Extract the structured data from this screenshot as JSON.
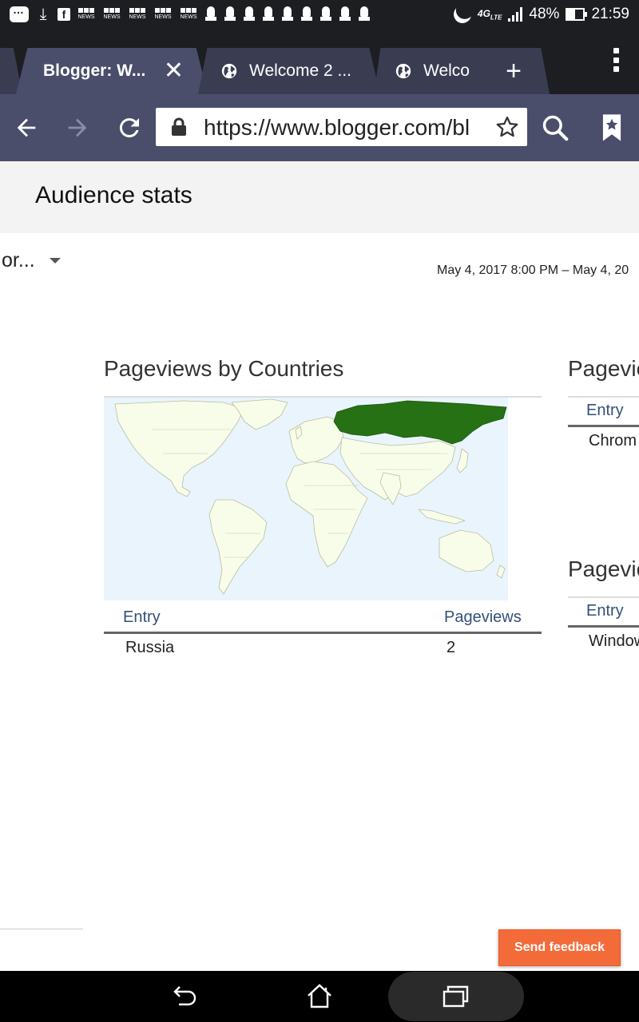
{
  "status_bar": {
    "battery": "48%",
    "time": "21:59",
    "network": "4G",
    "network_sub": "LTE",
    "news_badge": "NEWS",
    "icons": [
      "notification-icon",
      "download-icon",
      "facebook-icon",
      "bbc-news-icon",
      "bbc-news-icon",
      "bbc-news-icon",
      "bbc-news-icon",
      "bbc-news-icon",
      "pin-icon",
      "moon-icon",
      "signal-icon",
      "battery-icon"
    ]
  },
  "tabs": [
    {
      "label": "Blogger: W...",
      "active": true
    },
    {
      "label": "Welcome 2 ...",
      "active": false
    },
    {
      "label": "Welco",
      "active": false
    }
  ],
  "tab_icons": {
    "close": "close-icon",
    "new_tab": "plus-icon",
    "menu": "more-vert-icon",
    "site": "globe-icon"
  },
  "toolbar": {
    "url": "https://www.blogger.com/bl",
    "icons": [
      "back-arrow-icon",
      "forward-arrow-icon",
      "reload-icon",
      "lock-icon",
      "star-icon",
      "search-icon",
      "bookmark-icon"
    ]
  },
  "page": {
    "title": "Audience stats",
    "selector": "or...",
    "date_range": "May 4, 2017 8:00 PM – May 4, 20"
  },
  "countries": {
    "title": "Pageviews by Countries",
    "col_entry": "Entry",
    "col_pageviews": "Pageviews",
    "rows": [
      {
        "entry": "Russia",
        "pageviews": "2"
      }
    ]
  },
  "browsers": {
    "title": "Pagevie",
    "col_entry": "Entry",
    "row": "Chrom"
  },
  "os": {
    "title": "Pagevie",
    "col_entry": "Entry",
    "row": "Window"
  },
  "map": {
    "ocean_color": "#eaf4fd",
    "land_color": "#f7fde8",
    "highlight_color": "#267114",
    "highlighted_country": "Russia"
  },
  "feedback": {
    "label": "Send feedback",
    "color": "#f46b3a"
  },
  "navbar": {
    "icons": [
      "back-icon",
      "home-icon",
      "recent-apps-icon"
    ]
  }
}
